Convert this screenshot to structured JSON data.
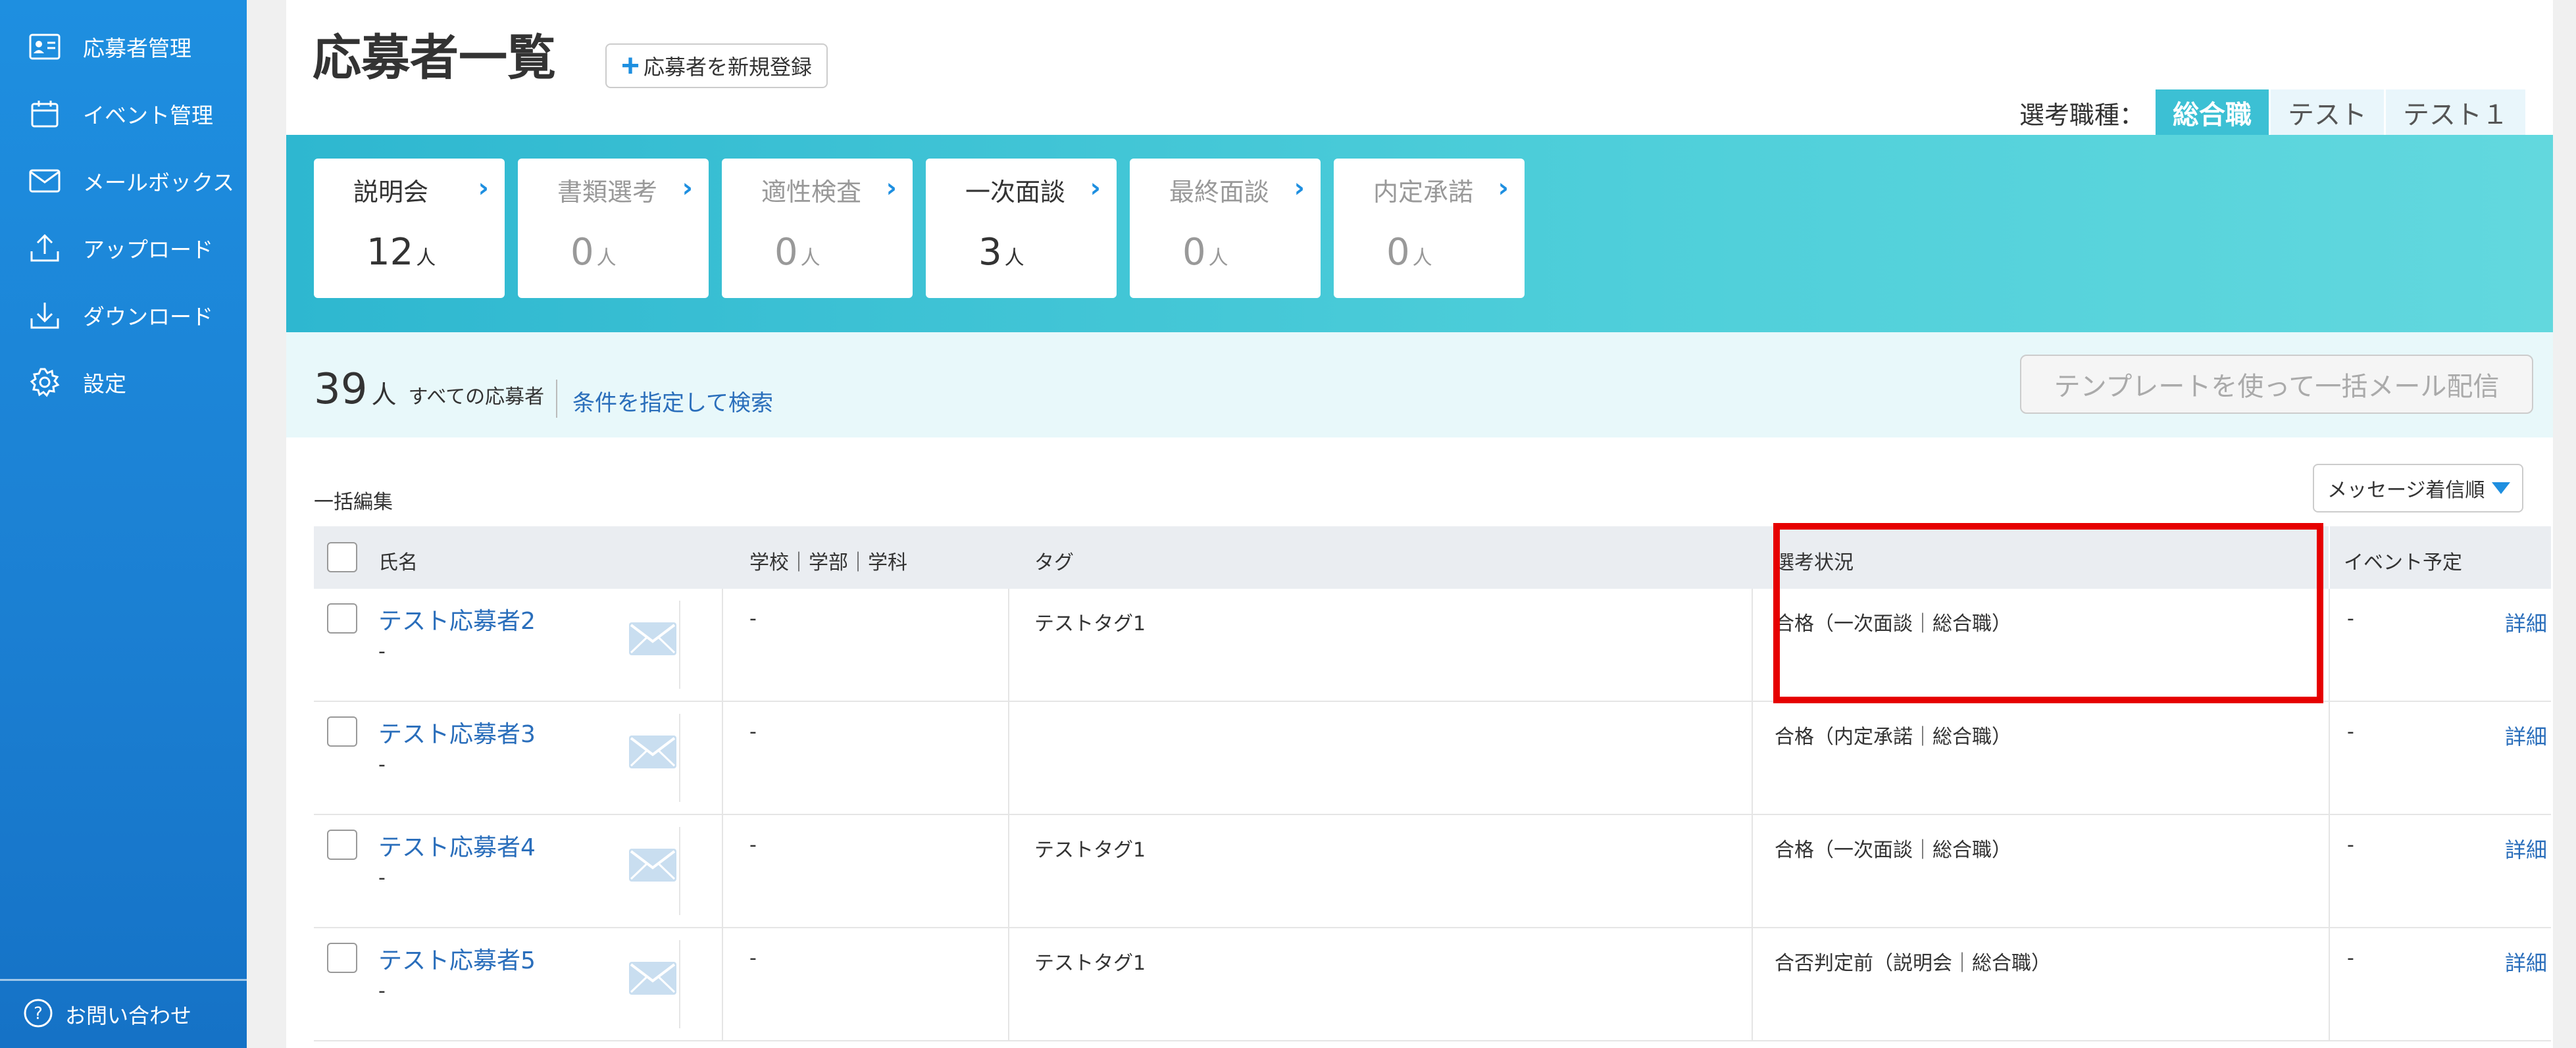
{
  "sidebar": {
    "items": [
      {
        "label": "応募者管理",
        "icon": "applicant-card-icon"
      },
      {
        "label": "イベント管理",
        "icon": "calendar-icon"
      },
      {
        "label": "メールボックス",
        "icon": "mail-icon"
      },
      {
        "label": "アップロード",
        "icon": "upload-icon"
      },
      {
        "label": "ダウンロード",
        "icon": "download-icon"
      },
      {
        "label": "設定",
        "icon": "gear-icon"
      }
    ],
    "contact_label": "お問い合わせ"
  },
  "header": {
    "title": "応募者一覧",
    "add_button_label": "応募者を新規登録",
    "job_type_label": "選考職種：",
    "job_types": [
      "総合職",
      "テスト",
      "テスト１"
    ],
    "job_type_selected": "総合職"
  },
  "pipeline": {
    "unit": "人",
    "stages": [
      {
        "name": "説明会",
        "count": "12"
      },
      {
        "name": "書類選考",
        "count": "0"
      },
      {
        "name": "適性検査",
        "count": "0"
      },
      {
        "name": "一次面談",
        "count": "3"
      },
      {
        "name": "最終面談",
        "count": "0"
      },
      {
        "name": "内定承諾",
        "count": "0"
      }
    ]
  },
  "summary": {
    "total": "39",
    "unit": "人",
    "total_label": "すべての応募者",
    "search_link": "条件を指定して検索",
    "template_button": "テンプレートを使って一括メール配信"
  },
  "list": {
    "bulk_edit_label": "一括編集",
    "sort_label": "メッセージ着信順",
    "columns": {
      "name": "氏名",
      "school": "学校｜学部｜学科",
      "tag": "タグ",
      "status": "選考状況",
      "event": "イベント予定"
    },
    "rows": [
      {
        "name": "テスト応募者2",
        "sub": "-",
        "school": "-",
        "tag": "テストタグ1",
        "status": "合格（一次面談｜総合職）",
        "event": "-",
        "detail": "詳細"
      },
      {
        "name": "テスト応募者3",
        "sub": "-",
        "school": "-",
        "tag": "",
        "status": "合格（内定承諾｜総合職）",
        "event": "-",
        "detail": "詳細"
      },
      {
        "name": "テスト応募者4",
        "sub": "-",
        "school": "-",
        "tag": "テストタグ1",
        "status": "合格（一次面談｜総合職）",
        "event": "-",
        "detail": "詳細"
      },
      {
        "name": "テスト応募者5",
        "sub": "-",
        "school": "-",
        "tag": "テストタグ1",
        "status": "合否判定前（説明会｜総合職）",
        "event": "-",
        "detail": "詳細"
      }
    ]
  },
  "colors": {
    "sidebar": "#1e8fe0",
    "accent": "#3cc0d4",
    "link": "#2a6ebb",
    "highlight": "#e60000"
  }
}
